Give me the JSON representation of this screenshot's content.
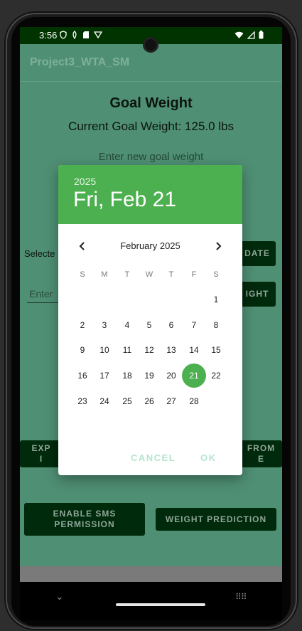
{
  "status_bar": {
    "time": "3:56"
  },
  "app_bar": {
    "title": "Project3_WTA_SM"
  },
  "goal": {
    "title": "Goal Weight",
    "current": "Current Goal Weight: 125.0 lbs",
    "enter_prompt": "Enter new goal weight"
  },
  "fields": {
    "selected_date_label": "Selecte",
    "enter_weight_placeholder": "Enter"
  },
  "buttons": {
    "date_partial": "DATE",
    "weight_partial": "IGHT",
    "export_partial": "EXP\nI",
    "from_partial": "FROM\nE",
    "sms": "ENABLE SMS\nPERMISSION",
    "prediction": "WEIGHT PREDICTION"
  },
  "date_picker": {
    "header_year": "2025",
    "header_date": "Fri, Feb 21",
    "month_label": "February 2025",
    "weekdays": [
      "S",
      "M",
      "T",
      "W",
      "T",
      "F",
      "S"
    ],
    "weeks": [
      [
        "",
        "",
        "",
        "",
        "",
        "",
        "1"
      ],
      [
        "2",
        "3",
        "4",
        "5",
        "6",
        "7",
        "8"
      ],
      [
        "9",
        "10",
        "11",
        "12",
        "13",
        "14",
        "15"
      ],
      [
        "16",
        "17",
        "18",
        "19",
        "20",
        "21",
        "22"
      ],
      [
        "23",
        "24",
        "25",
        "26",
        "27",
        "28",
        ""
      ]
    ],
    "selected_day": "21",
    "cancel_label": "CANCEL",
    "ok_label": "OK",
    "accent_color": "#4caf50"
  }
}
